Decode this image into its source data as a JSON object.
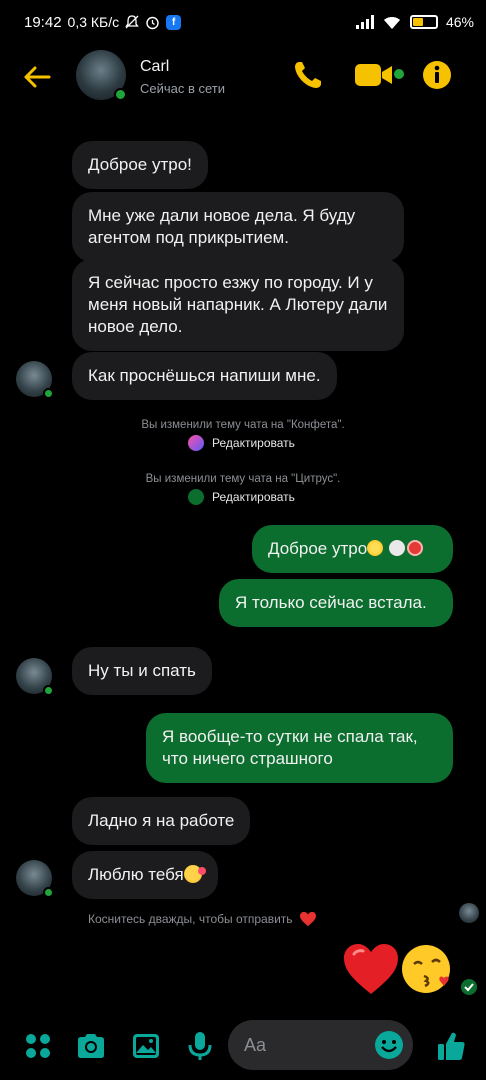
{
  "status_bar": {
    "time": "19:42",
    "net_speed": "0,3 КБ/с",
    "battery": "46%",
    "battery_level": 0.46
  },
  "header": {
    "contact_name": "Carl",
    "status": "Сейчас в сети"
  },
  "messages": {
    "m1": "Доброе утро!",
    "m2": "Мне уже дали новое дела. Я буду агентом под прикрытием.",
    "m3": "Я сейчас просто езжу по городу. И у меня новый напарник. А Лютеру дали новое дело.",
    "m4": "Как проснёшься напиши мне.",
    "sys1": "Вы изменили тему чата на \"Конфета\".",
    "sys_edit_1": "Редактировать",
    "sys2": "Вы изменили тему чата на \"Цитрус\".",
    "sys_edit_2": "Редактировать",
    "o1": "Доброе утро",
    "o2": "Я только сейчас встала.",
    "m5": "Ну ты и спать",
    "o3": "Я вообще-то сутки не спала так, что ничего страшного",
    "m6": "Ладно я на работе",
    "m7": "Люблю тебя",
    "hint": "Коснитесь дважды, чтобы отправить"
  },
  "composer": {
    "placeholder": "Aa"
  },
  "colors": {
    "accent": "#f6c200",
    "outgoing": "#0b6e2e",
    "incoming": "#1c1c1e",
    "online": "#1fa53a",
    "toolbar": "#0aa89b"
  },
  "icons": [
    "back-arrow-icon",
    "phone-icon",
    "video-icon",
    "info-icon",
    "apps-icon",
    "camera-icon",
    "gallery-icon",
    "mic-icon",
    "emoji-icon",
    "thumbs-up-icon",
    "heart-icon",
    "kiss-face-icon",
    "check-icon"
  ]
}
